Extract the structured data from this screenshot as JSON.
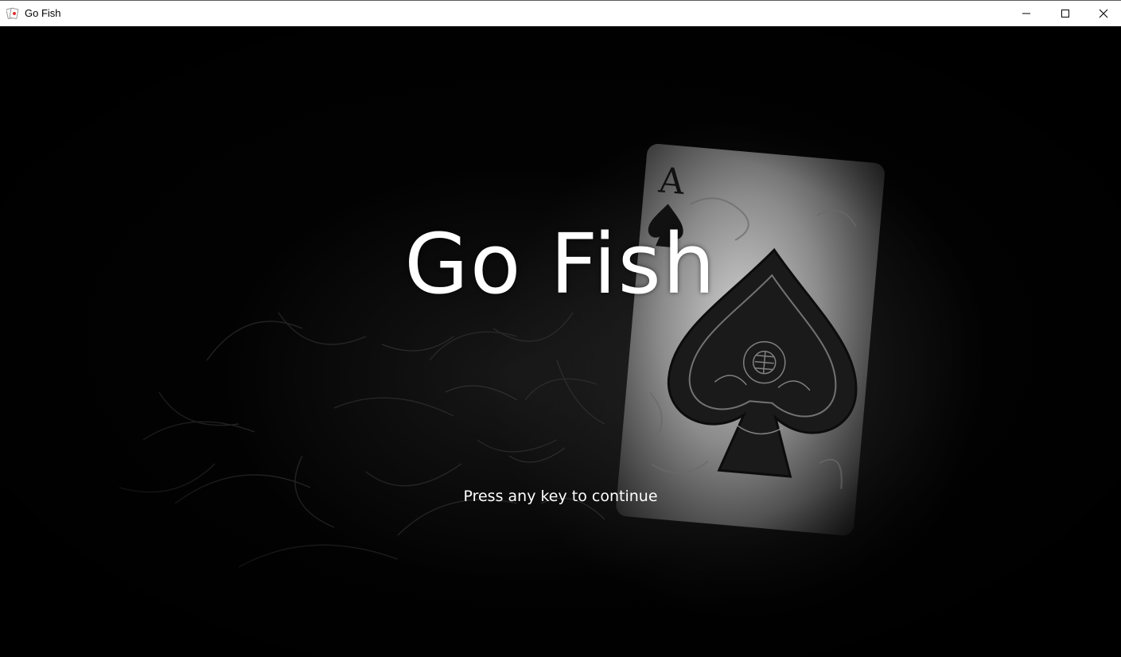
{
  "window": {
    "title": "Go Fish",
    "icon": "playing-cards-icon",
    "controls": [
      "minimize-icon",
      "maximize-icon",
      "close-icon"
    ]
  },
  "splash": {
    "title": "Go Fish",
    "prompt": "Press any key to continue"
  },
  "card": {
    "rank": "A",
    "suit": "spade"
  }
}
